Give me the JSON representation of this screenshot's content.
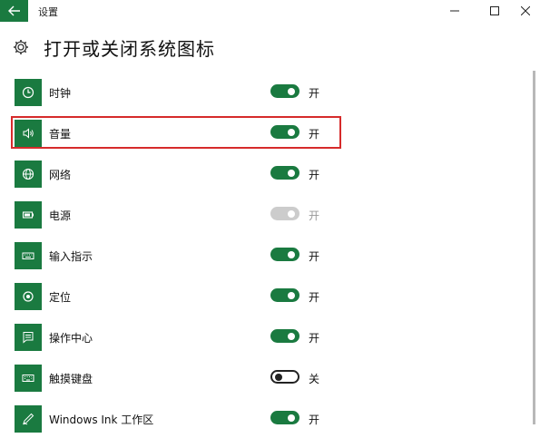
{
  "window": {
    "title": "设置",
    "back_icon": "arrow-left-icon",
    "minimize_icon": "minimize-icon",
    "maximize_icon": "maximize-icon",
    "close_icon": "close-icon"
  },
  "header": {
    "icon": "gear-icon",
    "title": "打开或关闭系统图标"
  },
  "colors": {
    "accent": "#1a7a40",
    "highlight_border": "#d62b2b",
    "toggle_disabled": "#cccccc"
  },
  "items": [
    {
      "label": "时钟",
      "icon": "clock-icon",
      "state": "开",
      "toggle": "on"
    },
    {
      "label": "音量",
      "icon": "volume-icon",
      "state": "开",
      "toggle": "on",
      "highlighted": true
    },
    {
      "label": "网络",
      "icon": "globe-icon",
      "state": "开",
      "toggle": "on"
    },
    {
      "label": "电源",
      "icon": "battery-icon",
      "state": "开",
      "toggle": "disabled"
    },
    {
      "label": "输入指示",
      "icon": "keyboard-icon",
      "state": "开",
      "toggle": "on"
    },
    {
      "label": "定位",
      "icon": "location-icon",
      "state": "开",
      "toggle": "on"
    },
    {
      "label": "操作中心",
      "icon": "action-center-icon",
      "state": "开",
      "toggle": "on"
    },
    {
      "label": "触摸键盘",
      "icon": "touch-keyboard-icon",
      "state": "关",
      "toggle": "off"
    },
    {
      "label": "Windows Ink 工作区",
      "icon": "pen-icon",
      "state": "开",
      "toggle": "on"
    }
  ]
}
